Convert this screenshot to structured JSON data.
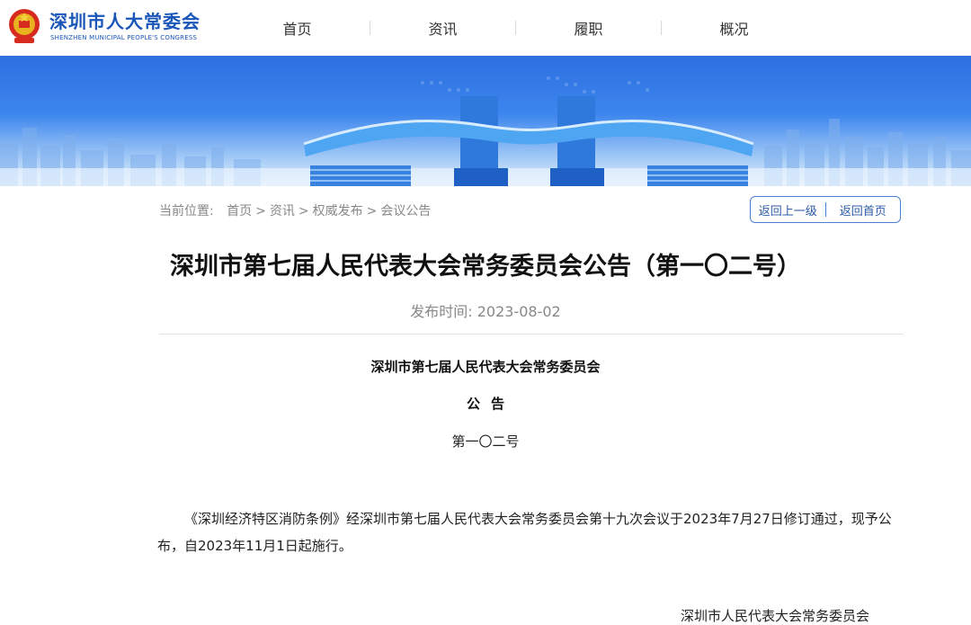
{
  "header": {
    "brand_cn": "深圳市人大常委会",
    "brand_en": "SHENZHEN MUNICIPAL PEOPLE'S CONGRESS",
    "nav": [
      "首页",
      "资讯",
      "履职",
      "概况"
    ]
  },
  "breadcrumb": {
    "prefix": "当前位置:",
    "items": [
      "首页",
      "资讯",
      "权威发布",
      "会议公告"
    ],
    "separator": ">"
  },
  "actions": {
    "back_label": "返回上一级",
    "home_label": "返回首页"
  },
  "article": {
    "title": "深圳市第七届人民代表大会常务委员会公告（第一〇二号）",
    "publish_date": "发布时间: 2023-08-02",
    "org": "深圳市第七届人民代表大会常务委员会",
    "notice_label": "公告",
    "doc_number": "第一〇二号",
    "body": "《深圳经济特区消防条例》经深圳市第七届人民代表大会常务委员会第十九次会议于2023年7月27日修订通过，现予公布，自2023年11月1日起施行。",
    "signature": "深圳市人民代表大会常务委员会"
  },
  "colors": {
    "brand_blue": "#1a56b8",
    "banner_blue": "#3d86ee",
    "button_border": "#4a7fd1"
  }
}
